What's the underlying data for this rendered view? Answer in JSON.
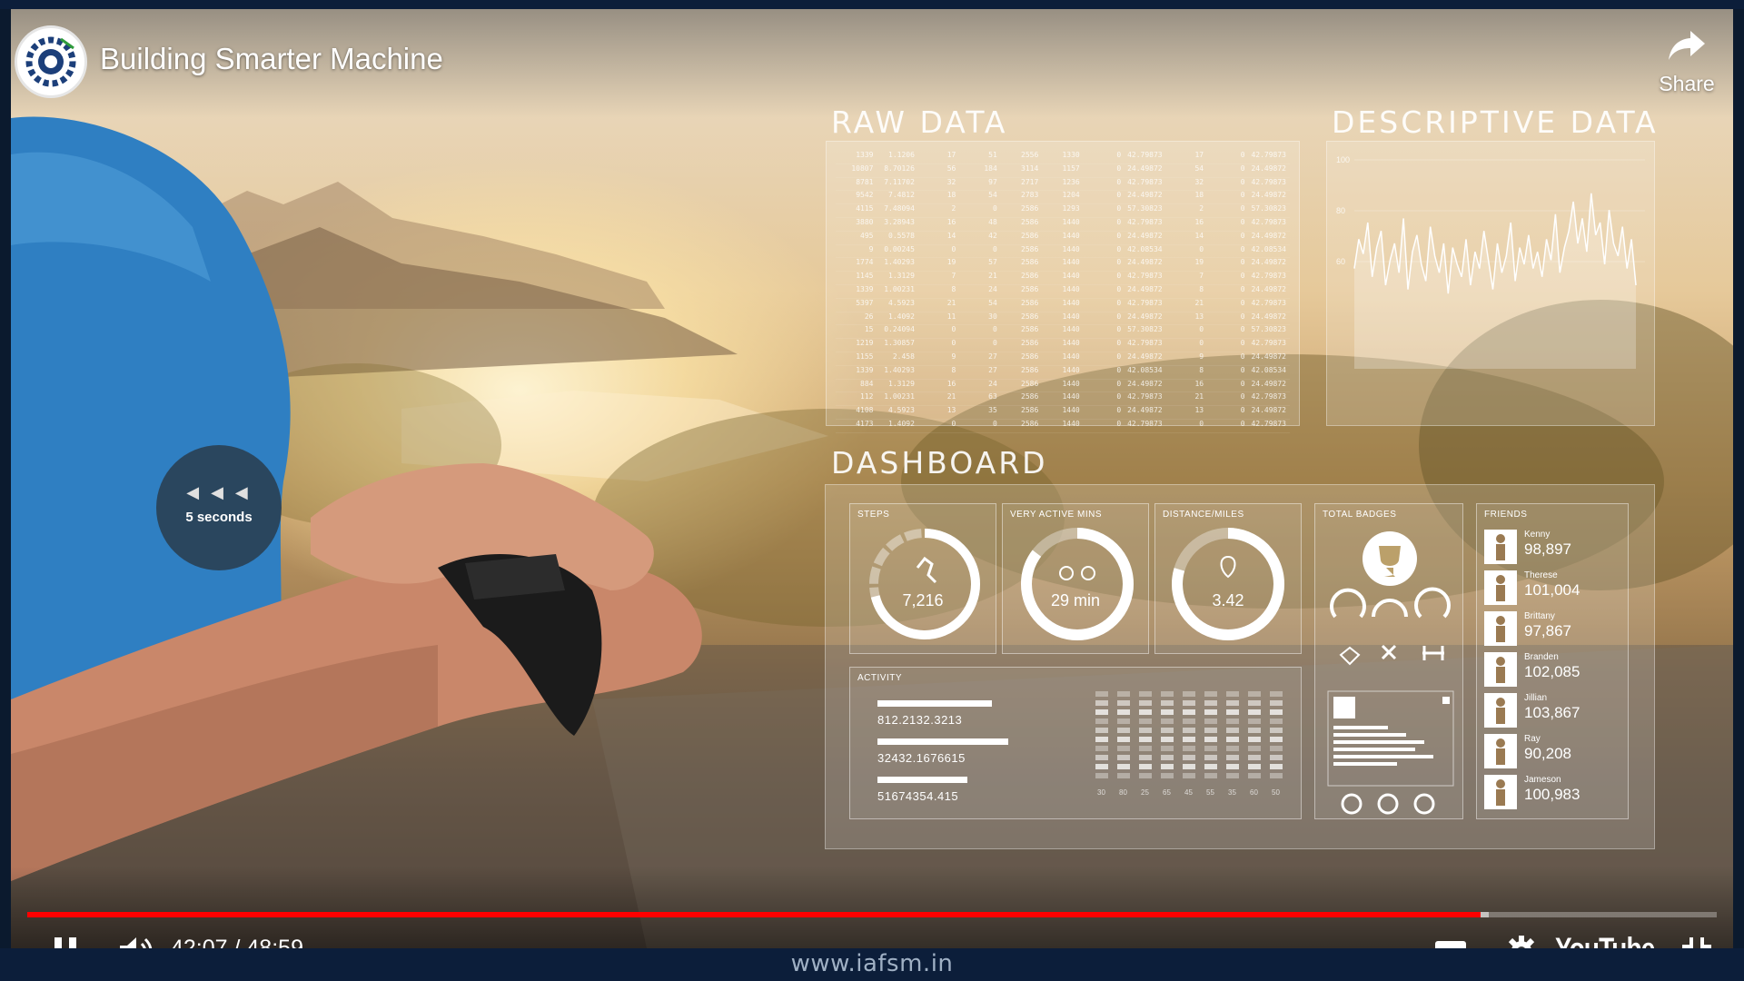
{
  "video": {
    "title": "Building Smarter Machine",
    "share_label": "Share",
    "seek_hint": "5 seconds",
    "current_time": "42:07",
    "duration": "48:59",
    "played_fraction": 0.86,
    "buffered_fraction": 0.865,
    "brand": "YouTube"
  },
  "footer": {
    "url": "www.iafsm.in"
  },
  "overlay": {
    "raw_title": "RAW DATA",
    "descriptive_title": "DESCRIPTIVE DATA",
    "dashboard_title": "DASHBOARD",
    "raw_rows": [
      [
        "1339",
        "1.1206",
        "17",
        "51",
        "2556",
        "1330",
        "0",
        "42.79873",
        "17",
        "0",
        "42.79873"
      ],
      [
        "10807",
        "8.70126",
        "56",
        "184",
        "3114",
        "1157",
        "0",
        "24.49872",
        "54",
        "0",
        "24.49872"
      ],
      [
        "8781",
        "7.11702",
        "32",
        "97",
        "2717",
        "1236",
        "0",
        "42.79873",
        "32",
        "0",
        "42.79873"
      ],
      [
        "9542",
        "7.4812",
        "18",
        "54",
        "2783",
        "1204",
        "0",
        "24.49872",
        "18",
        "0",
        "24.49872"
      ],
      [
        "4115",
        "7.48094",
        "2",
        "0",
        "2586",
        "1293",
        "0",
        "57.30823",
        "2",
        "0",
        "57.30823"
      ],
      [
        "3880",
        "3.28943",
        "16",
        "48",
        "2586",
        "1440",
        "0",
        "42.79873",
        "16",
        "0",
        "42.79873"
      ],
      [
        "495",
        "0.5578",
        "14",
        "42",
        "2586",
        "1440",
        "0",
        "24.49872",
        "14",
        "0",
        "24.49872"
      ],
      [
        "9",
        "0.00245",
        "0",
        "0",
        "2586",
        "1440",
        "0",
        "42.08534",
        "0",
        "0",
        "42.08534"
      ],
      [
        "1774",
        "1.40293",
        "19",
        "57",
        "2586",
        "1440",
        "0",
        "24.49872",
        "19",
        "0",
        "24.49872"
      ],
      [
        "1145",
        "1.3129",
        "7",
        "21",
        "2586",
        "1440",
        "0",
        "42.79873",
        "7",
        "0",
        "42.79873"
      ],
      [
        "1339",
        "1.00231",
        "8",
        "24",
        "2586",
        "1440",
        "0",
        "24.49872",
        "8",
        "0",
        "24.49872"
      ],
      [
        "5397",
        "4.5923",
        "21",
        "54",
        "2586",
        "1440",
        "0",
        "42.79873",
        "21",
        "0",
        "42.79873"
      ],
      [
        "26",
        "1.4092",
        "11",
        "30",
        "2586",
        "1440",
        "0",
        "24.49872",
        "13",
        "0",
        "24.49872"
      ],
      [
        "15",
        "0.24094",
        "0",
        "0",
        "2586",
        "1440",
        "0",
        "57.30823",
        "0",
        "0",
        "57.30823"
      ],
      [
        "1219",
        "1.30857",
        "0",
        "0",
        "2586",
        "1440",
        "0",
        "42.79873",
        "0",
        "0",
        "42.79873"
      ],
      [
        "1155",
        "2.458",
        "9",
        "27",
        "2586",
        "1440",
        "0",
        "24.49872",
        "9",
        "0",
        "24.49872"
      ],
      [
        "1339",
        "1.40293",
        "8",
        "27",
        "2586",
        "1440",
        "0",
        "42.08534",
        "8",
        "0",
        "42.08534"
      ],
      [
        "884",
        "1.3129",
        "16",
        "24",
        "2586",
        "1440",
        "0",
        "24.49872",
        "16",
        "0",
        "24.49872"
      ],
      [
        "112",
        "1.00231",
        "21",
        "63",
        "2586",
        "1440",
        "0",
        "42.79873",
        "21",
        "0",
        "42.79873"
      ],
      [
        "4108",
        "4.5923",
        "13",
        "35",
        "2586",
        "1440",
        "0",
        "24.49872",
        "13",
        "0",
        "24.49872"
      ],
      [
        "4173",
        "1.4092",
        "0",
        "0",
        "2586",
        "1440",
        "0",
        "42.79873",
        "0",
        "0",
        "42.79873"
      ]
    ],
    "descriptive_ticks": [
      "100",
      "80",
      "60"
    ],
    "descriptive_series": [
      48,
      62,
      55,
      70,
      44,
      58,
      66,
      40,
      52,
      60,
      46,
      72,
      38,
      56,
      64,
      50,
      42,
      68,
      54,
      46,
      60,
      36,
      58,
      50,
      44,
      62,
      40,
      56,
      48,
      66,
      52,
      38,
      60,
      46,
      54,
      70,
      42,
      58,
      50,
      64,
      48,
      56,
      44,
      62,
      52,
      74,
      46,
      58,
      66,
      80,
      60,
      72,
      56,
      84,
      64,
      70,
      50,
      76,
      60,
      54,
      68,
      48,
      62,
      40
    ],
    "tiles": {
      "steps_label": "STEPS",
      "steps_value": "7,216",
      "active_label": "VERY ACTIVE MINS",
      "active_value": "29 min",
      "distance_label": "DISTANCE/MILES",
      "distance_value": "3.42",
      "badges_label": "TOTAL BADGES",
      "friends_label": "FRIENDS",
      "activity_label": "ACTIVITY"
    },
    "activity_rows": [
      {
        "value": "812.2132.3213",
        "fill": 0.7
      },
      {
        "value": "32432.1676615",
        "fill": 0.8
      },
      {
        "value": "51674354.415",
        "fill": 0.55
      }
    ],
    "activity_axis": [
      "30",
      "80",
      "25",
      "65",
      "45",
      "55",
      "35",
      "60",
      "50"
    ],
    "friends": [
      {
        "name": "Kenny",
        "score": "98,897"
      },
      {
        "name": "Therese",
        "score": "101,004"
      },
      {
        "name": "Brittany",
        "score": "97,867"
      },
      {
        "name": "Branden",
        "score": "102,085"
      },
      {
        "name": "Jillian",
        "score": "103,867"
      },
      {
        "name": "Ray",
        "score": "90,208"
      },
      {
        "name": "Jameson",
        "score": "100,983"
      }
    ]
  },
  "colors": {
    "played": "#ff0000",
    "panel_text": "#ffffff",
    "frame": "#0c1e3a"
  }
}
